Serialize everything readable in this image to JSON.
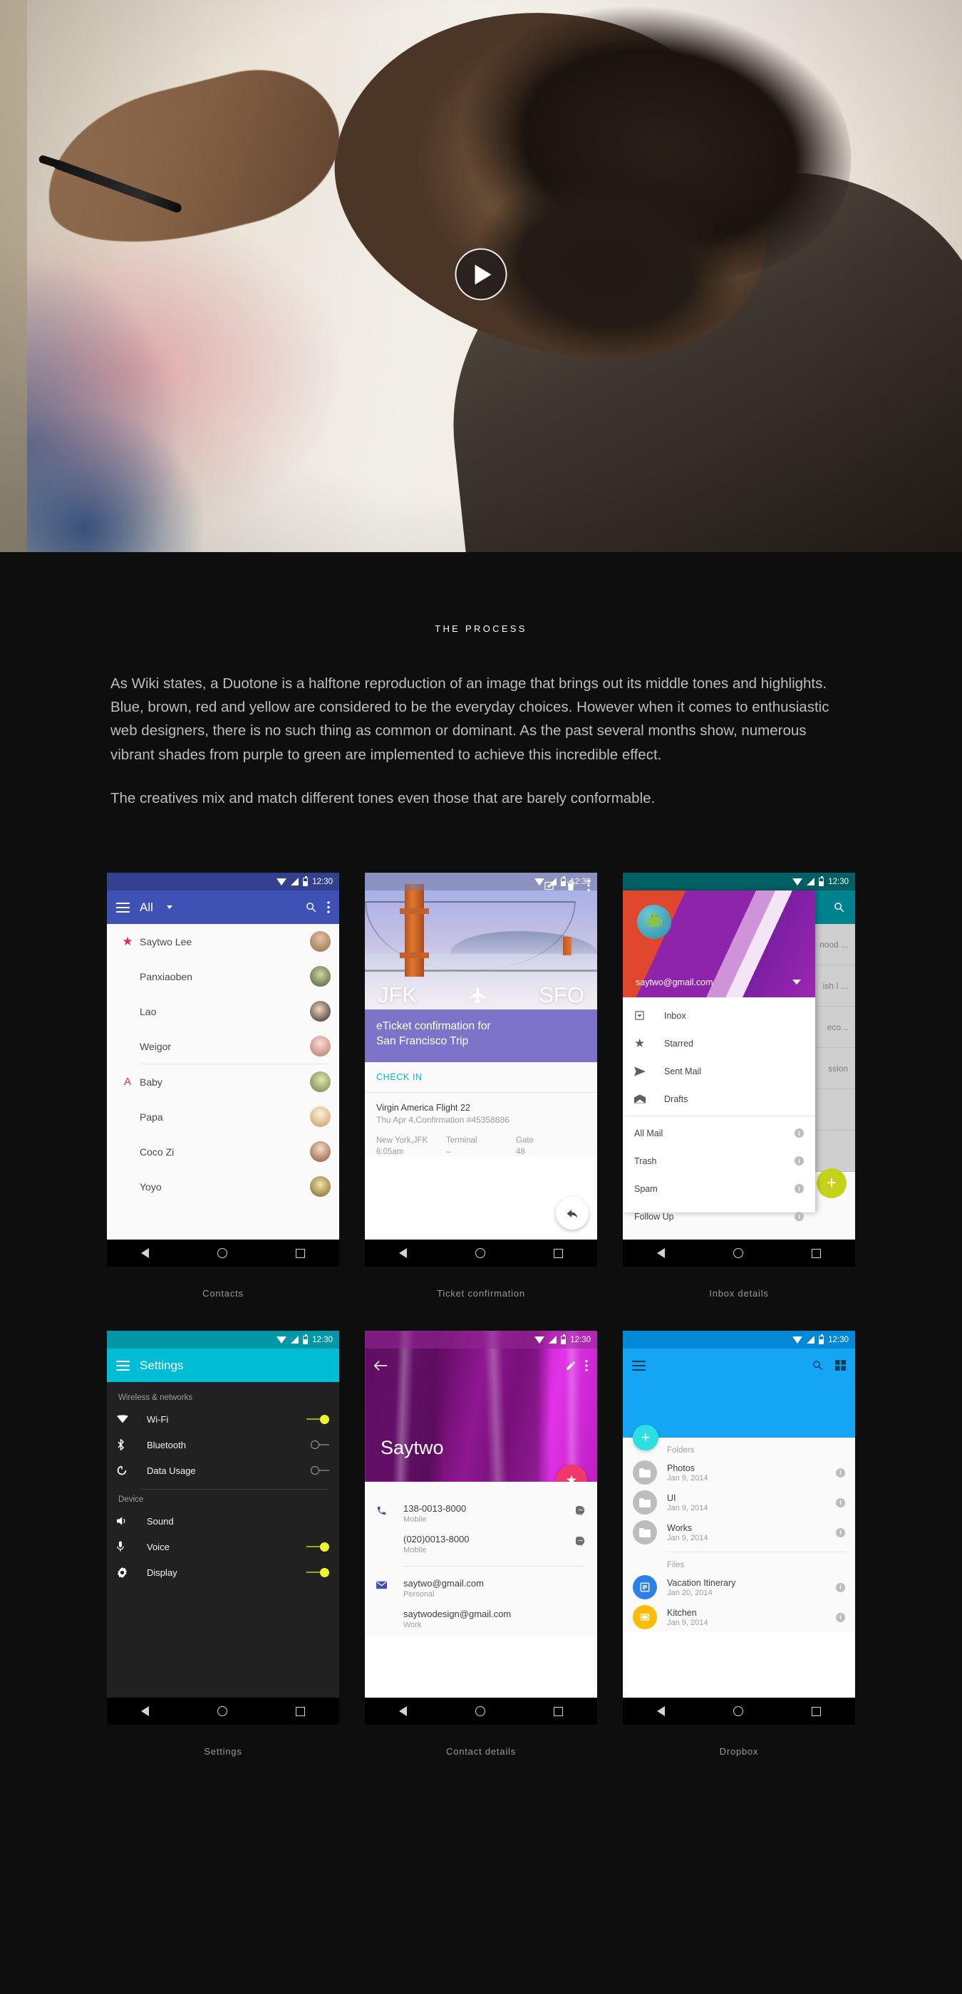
{
  "hero": {
    "play_label": "play-video"
  },
  "section": {
    "label": "THE PROCESS",
    "paragraphs": [
      "As Wiki states, a Duotone is a halftone reproduction of an image that brings out its middle tones and highlights. Blue, brown, red and yellow are considered to be the everyday choices. However when it comes to enthusiastic web designers, there is no such thing as common or dominant. As the past several months show, numerous vibrant shades from purple to green are implemented to achieve this incredible effect.",
      "The creatives mix and match different tones even those that are barely conformable."
    ]
  },
  "status": {
    "time": "12:30"
  },
  "screens": {
    "contacts": {
      "caption": "Contacts",
      "appbar": {
        "title": "All"
      },
      "rows": [
        {
          "key": "star",
          "name": "Saytwo Lee"
        },
        {
          "key": "",
          "name": "Panxiaoben"
        },
        {
          "key": "",
          "name": "Lao"
        },
        {
          "key": "",
          "name": "Weigor"
        },
        {
          "key": "A",
          "name": "Baby"
        },
        {
          "key": "",
          "name": "Papa"
        },
        {
          "key": "",
          "name": "Coco Zi"
        },
        {
          "key": "",
          "name": "Yoyo"
        }
      ]
    },
    "ticket": {
      "caption": "Ticket confirmation",
      "origin": "JFK",
      "destination": "SFO",
      "subject_line1": "eTicket confirmation for",
      "subject_line2": "San Francisco Trip",
      "check_in": "CHECK IN",
      "flight_name": "Virgin America Flight 22",
      "flight_sub": "Thu Apr 4,Confirmation #45358886",
      "detail_cols": [
        {
          "label": "New York,JFK",
          "value": "6:05am"
        },
        {
          "label": "Terminal",
          "value": "–"
        },
        {
          "label": "Gate",
          "value": "48"
        }
      ]
    },
    "inbox": {
      "caption": "Inbox details",
      "account_email": "saytwo@gmail.com",
      "avatar_label": "android",
      "primary_items": [
        {
          "icon": "inbox-icon",
          "label": "Inbox"
        },
        {
          "icon": "star-icon",
          "label": "Starred"
        },
        {
          "icon": "send-icon",
          "label": "Sent Mail"
        },
        {
          "icon": "drafts-icon",
          "label": "Drafts"
        }
      ],
      "secondary_items": [
        {
          "label": "All Mail",
          "badge": "i"
        },
        {
          "label": "Trash",
          "badge": "i"
        },
        {
          "label": "Spam",
          "badge": "i"
        },
        {
          "label": "Follow Up",
          "badge": "i"
        }
      ],
      "background_rows": [
        "nood ...",
        "ish I ...",
        "eco...",
        "ssion"
      ],
      "fab": "+"
    },
    "settings": {
      "caption": "Settings",
      "appbar": {
        "title": "Settings"
      },
      "groups": [
        {
          "header": "Wireless & networks",
          "rows": [
            {
              "icon": "wifi-icon",
              "label": "Wi-Fi",
              "toggle": "on"
            },
            {
              "icon": "bluetooth-icon",
              "label": "Bluetooth",
              "toggle": "off"
            },
            {
              "icon": "data-usage-icon",
              "label": "Data Usage",
              "toggle": "off"
            }
          ]
        },
        {
          "header": "Device",
          "rows": [
            {
              "icon": "sound-icon",
              "label": "Sound",
              "toggle": "none"
            },
            {
              "icon": "voice-icon",
              "label": "Voice",
              "toggle": "on"
            },
            {
              "icon": "display-icon",
              "label": "Display",
              "toggle": "on"
            }
          ]
        }
      ]
    },
    "contact_details": {
      "caption": "Contact details",
      "name": "Saytwo",
      "phones": [
        {
          "value": "138-0013-8000",
          "label": "Mobile"
        },
        {
          "value": "(020)0013-8000",
          "label": "Mobile"
        }
      ],
      "emails": [
        {
          "value": "saytwo@gmail.com",
          "label": "Personal"
        },
        {
          "value": "saytwodesign@gmail.com",
          "label": "Work"
        }
      ]
    },
    "dropbox": {
      "caption": "Dropbox",
      "fab": "+",
      "folders_header": "Folders",
      "folders": [
        {
          "name": "Photos",
          "date": "Jan 9, 2014"
        },
        {
          "name": "UI",
          "date": "Jan 9, 2014"
        },
        {
          "name": "Works",
          "date": "Jan 9, 2014"
        }
      ],
      "files_header": "Files",
      "files": [
        {
          "name": "Vacation Itinerary",
          "date": "Jan 20, 2014",
          "kind": "doc"
        },
        {
          "name": "Kitchen",
          "date": "Jan 9, 2014",
          "kind": "pres"
        }
      ]
    }
  },
  "colors": {
    "page_bg": "#0e0e0e",
    "contacts_accent": "#3f51b5",
    "ticket_accent": "#7d74c9",
    "gmail_accent": "#00838f",
    "settings_accent": "#00bcd4",
    "contact_accent": "#f0386b",
    "dropbox_accent": "#15a5f5"
  }
}
